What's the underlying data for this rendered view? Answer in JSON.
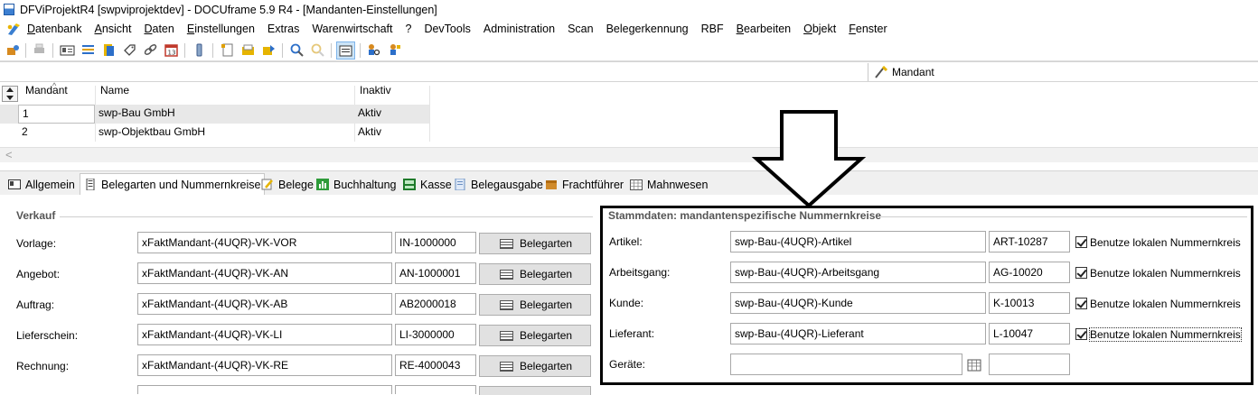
{
  "window": {
    "title": "DFViProjektR4 [swpviprojektdev] - DOCUframe 5.9 R4 - [Mandanten-Einstellungen]"
  },
  "menu": [
    {
      "pre": "",
      "u": "D",
      "post": "atenbank"
    },
    {
      "pre": "",
      "u": "A",
      "post": "nsicht"
    },
    {
      "pre": "",
      "u": "D",
      "post": "aten"
    },
    {
      "pre": "",
      "u": "E",
      "post": "instellungen"
    },
    {
      "pre": "",
      "u": "",
      "post": "Extras"
    },
    {
      "pre": "",
      "u": "",
      "post": "Warenwirtschaft"
    },
    {
      "pre": "",
      "u": "",
      "post": "?"
    },
    {
      "pre": "",
      "u": "",
      "post": "DevTools"
    },
    {
      "pre": "",
      "u": "",
      "post": "Administration"
    },
    {
      "pre": "",
      "u": "",
      "post": "Scan"
    },
    {
      "pre": "",
      "u": "",
      "post": "Belegerkennung"
    },
    {
      "pre": "",
      "u": "",
      "post": "RBF"
    },
    {
      "pre": "",
      "u": "B",
      "post": "earbeiten"
    },
    {
      "pre": "",
      "u": "O",
      "post": "bjekt"
    },
    {
      "pre": "",
      "u": "F",
      "post": "enster"
    }
  ],
  "mandant_bar": {
    "label": "Mandant"
  },
  "grid": {
    "headers": [
      "Mandant",
      "Name",
      "Inaktiv"
    ],
    "rows": [
      {
        "mandant": "1",
        "name": "swp-Bau GmbH",
        "inaktiv": "Aktiv"
      },
      {
        "mandant": "2",
        "name": "swp-Objektbau GmbH",
        "inaktiv": "Aktiv"
      }
    ],
    "scroll_left": "<"
  },
  "tabs": [
    {
      "label": "Allgemein",
      "u": "A"
    },
    {
      "label": "Belegarten und Nummernkreise",
      "u": "N",
      "active": true
    },
    {
      "label": "Belege",
      "u": ""
    },
    {
      "label": "Buchhaltung",
      "u": "B"
    },
    {
      "label": "Kasse",
      "u": "K"
    },
    {
      "label": "Belegausgabe",
      "u": ""
    },
    {
      "label": "Frachtführer",
      "u": "F"
    },
    {
      "label": "Mahnwesen",
      "u": "M"
    }
  ],
  "verkauf": {
    "title": "Verkauf",
    "button_label": "Belegarten",
    "rows": [
      {
        "label": "Vorlage:",
        "value": "xFaktMandant-(4UQR)-VK-VOR",
        "number": "IN-1000000"
      },
      {
        "label": "Angebot:",
        "value": "xFaktMandant-(4UQR)-VK-AN",
        "number": "AN-1000001"
      },
      {
        "label": "Auftrag:",
        "value": "xFaktMandant-(4UQR)-VK-AB",
        "number": "AB2000018"
      },
      {
        "label": "Lieferschein:",
        "value": "xFaktMandant-(4UQR)-VK-LI",
        "number": "LI-3000000"
      },
      {
        "label": "Rechnung:",
        "value": "xFaktMandant-(4UQR)-VK-RE",
        "number": "RE-4000043"
      }
    ]
  },
  "stammdaten": {
    "title": "Stammdaten: mandantenspezifische Nummernkreise",
    "checkbox_label": "Benutze lokalen Nummernkreis",
    "rows": [
      {
        "label": "Artikel:",
        "value": "swp-Bau-(4UQR)-Artikel",
        "number": "ART-10287",
        "checked": true
      },
      {
        "label": "Arbeitsgang:",
        "value": "swp-Bau-(4UQR)-Arbeitsgang",
        "number": "AG-10020",
        "checked": true
      },
      {
        "label": "Kunde:",
        "value": "swp-Bau-(4UQR)-Kunde",
        "number": "K-10013",
        "checked": true
      },
      {
        "label": "Lieferant:",
        "value": "swp-Bau-(4UQR)-Lieferant",
        "number": "L-10047",
        "checked": true
      },
      {
        "label": "Geräte:",
        "value": "",
        "number": ""
      }
    ]
  }
}
